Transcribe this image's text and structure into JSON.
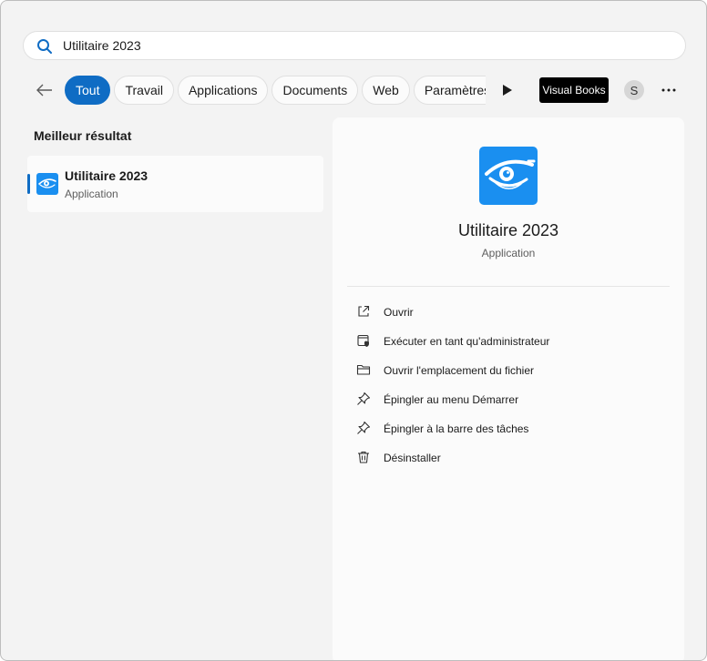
{
  "search": {
    "query": "Utilitaire 2023"
  },
  "filters": {
    "chips": [
      "Tout",
      "Travail",
      "Applications",
      "Documents",
      "Web",
      "Paramètres"
    ],
    "active_index": 0,
    "brand_label": "Visual Books",
    "avatar_initial": "S",
    "accent_color": "#0f6cc4"
  },
  "best_match": {
    "section_title": "Meilleur résultat",
    "name": "Utilitaire 2023",
    "type": "Application"
  },
  "preview": {
    "title": "Utilitaire 2023",
    "subtitle": "Application",
    "icon_color": "#1a8ff0",
    "actions": [
      {
        "label": "Ouvrir",
        "icon": "open-external-icon"
      },
      {
        "label": "Exécuter en tant qu'administrateur",
        "icon": "admin-shield-icon"
      },
      {
        "label": "Ouvrir l'emplacement du fichier",
        "icon": "folder-icon"
      },
      {
        "label": "Épingler au menu Démarrer",
        "icon": "pin-icon"
      },
      {
        "label": "Épingler à la barre des tâches",
        "icon": "pin-icon"
      },
      {
        "label": "Désinstaller",
        "icon": "trash-icon"
      }
    ]
  }
}
